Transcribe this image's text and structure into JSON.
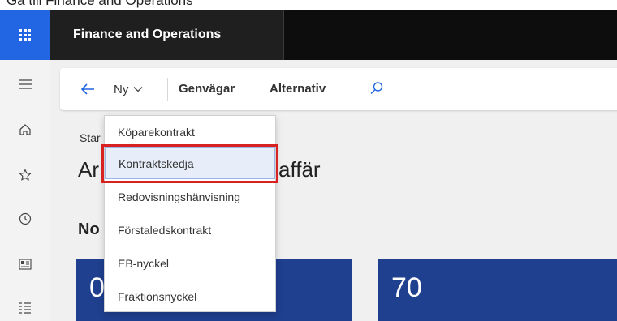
{
  "top_clipped_text": "Gå till Finance and Operations",
  "app": {
    "title": "Finance and Operations"
  },
  "icons": {
    "waffle": "waffle-icon",
    "hamburger": "hamburger-icon",
    "home": "home-icon",
    "favorites": "star-icon",
    "recent": "clock-icon",
    "workspaces": "workspace-icon",
    "modules": "list-icon",
    "back": "back-arrow-icon",
    "chevron": "chevron-down-icon",
    "search": "search-icon"
  },
  "actionpane": {
    "new_label": "Ny",
    "shortcuts_label": "Genvägar",
    "options_label": "Alternativ"
  },
  "page": {
    "breadcrumb": "Star",
    "title_start": "Ar",
    "title_end": "affär",
    "section_title": "No"
  },
  "tiles": [
    "0",
    "70"
  ],
  "new_menu": {
    "items": [
      "Köparekontrakt",
      "Kontraktskedja",
      "Redovisningshänvisning",
      "Förstaledskontrakt",
      "EB-nyckel",
      "Fraktionsnyckel"
    ],
    "selected_index": 1
  },
  "colors": {
    "waffle_bg": "#2266e3",
    "topbar_bg": "#0d0d0d",
    "tile_bg": "#1f3f8f",
    "highlight": "#d82121"
  }
}
